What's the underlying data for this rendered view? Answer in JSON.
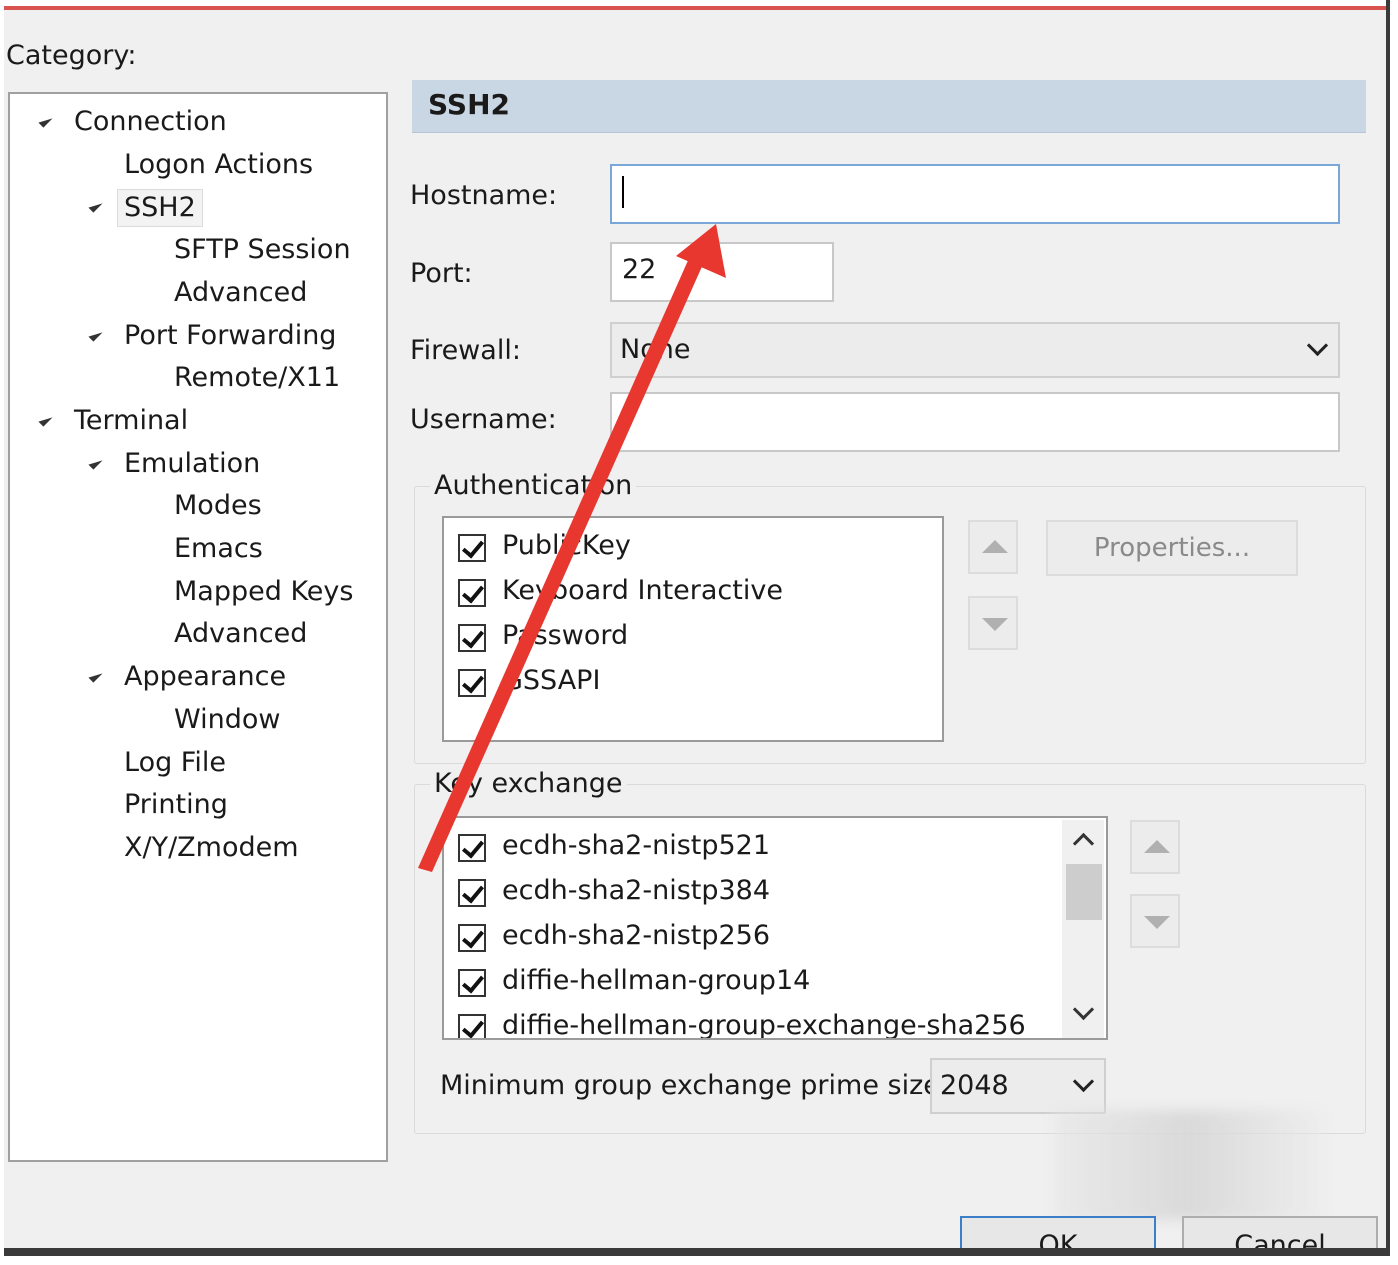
{
  "category_label": "Category:",
  "tree": [
    {
      "label": "Connection",
      "indent": 0,
      "expanded": true
    },
    {
      "label": "Logon Actions",
      "indent": 1
    },
    {
      "label": "SSH2",
      "indent": 1,
      "expanded": true,
      "selected": true
    },
    {
      "label": "SFTP Session",
      "indent": 2
    },
    {
      "label": "Advanced",
      "indent": 2
    },
    {
      "label": "Port Forwarding",
      "indent": 1,
      "expanded": true
    },
    {
      "label": "Remote/X11",
      "indent": 2
    },
    {
      "label": "Terminal",
      "indent": 0,
      "expanded": true
    },
    {
      "label": "Emulation",
      "indent": 1,
      "expanded": true
    },
    {
      "label": "Modes",
      "indent": 2
    },
    {
      "label": "Emacs",
      "indent": 2
    },
    {
      "label": "Mapped Keys",
      "indent": 2
    },
    {
      "label": "Advanced",
      "indent": 2
    },
    {
      "label": "Appearance",
      "indent": 1,
      "expanded": true
    },
    {
      "label": "Window",
      "indent": 2
    },
    {
      "label": "Log File",
      "indent": 1
    },
    {
      "label": "Printing",
      "indent": 1
    },
    {
      "label": "X/Y/Zmodem",
      "indent": 1
    }
  ],
  "panel": {
    "title": "SSH2",
    "hostname_label": "Hostname:",
    "hostname_value": "",
    "port_label": "Port:",
    "port_value": "22",
    "firewall_label": "Firewall:",
    "firewall_value": "None",
    "username_label": "Username:",
    "username_value": ""
  },
  "authentication": {
    "title": "Authentication",
    "items": [
      "PublicKey",
      "Keyboard Interactive",
      "Password",
      "GSSAPI"
    ],
    "properties_label": "Properties..."
  },
  "key_exchange": {
    "title": "Key exchange",
    "items": [
      "ecdh-sha2-nistp521",
      "ecdh-sha2-nistp384",
      "ecdh-sha2-nistp256",
      "diffie-hellman-group14",
      "diffie-hellman-group-exchange-sha256"
    ],
    "min_prime_label": "Minimum group exchange prime size:",
    "min_prime_value": "2048"
  },
  "buttons": {
    "ok": "OK",
    "cancel": "Cancel"
  },
  "colors": {
    "accent_border": "#d9534f",
    "annotation_arrow": "#e8372f",
    "header_bg": "#c9d6e4"
  }
}
